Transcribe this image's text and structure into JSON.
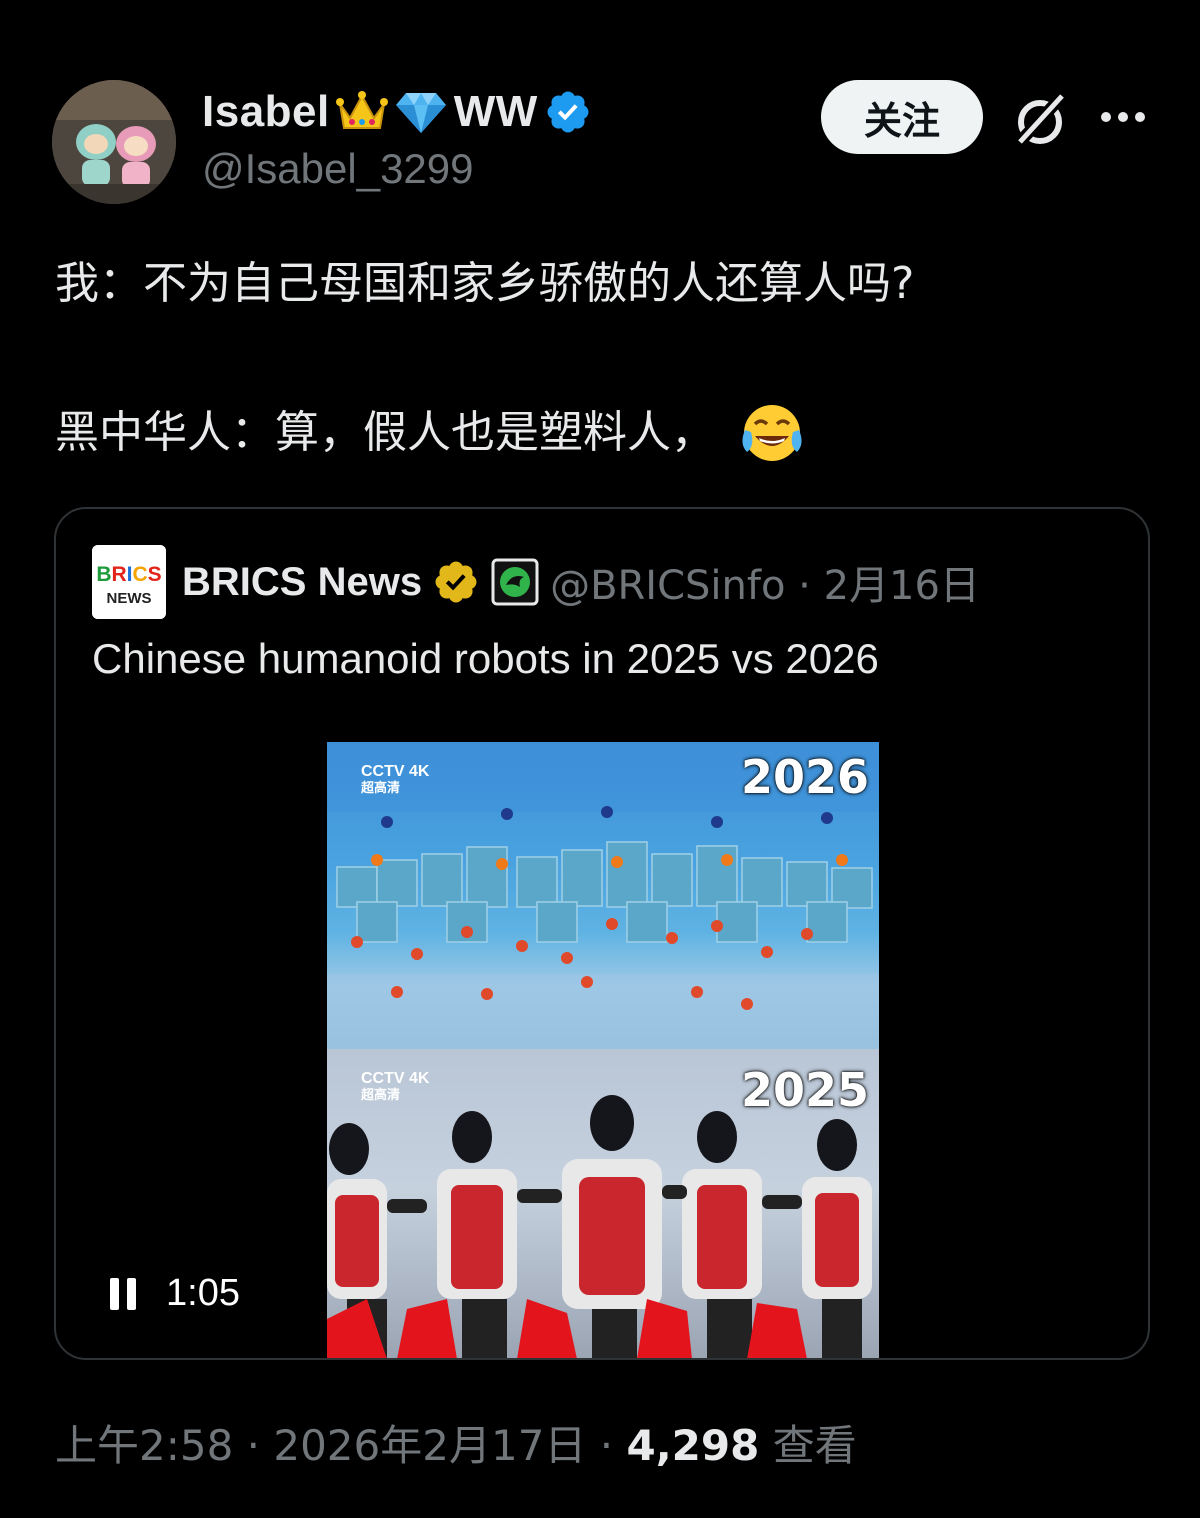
{
  "author": {
    "name": "Isabel",
    "name_suffix": "WW",
    "handle": "@Isabel_3299",
    "follow_label": "关注"
  },
  "post": {
    "line1": "我：不为自己母国和家乡骄傲的人还算人吗?",
    "line2": "黑中华人：算，假人也是塑料人，"
  },
  "quoted": {
    "logo_top": "BRICS",
    "logo_bottom": "NEWS",
    "name": "BRICS News",
    "handle_date": "@BRICSinfo · 2月16日",
    "text": "Chinese humanoid robots in 2025 vs 2026",
    "video": {
      "top_year": "2026",
      "bottom_year": "2025",
      "channel": "CCTV 4K",
      "channel_sub": "超高清",
      "duration": "1:05"
    }
  },
  "meta": {
    "time_date": "上午2:58 · 2026年2月17日 · ",
    "views": "4,298",
    "views_label": " 查看"
  },
  "colors": {
    "background": "#000000",
    "verified_blue": "#1d9bf0",
    "verified_gold": "#e2b719",
    "secondary_text": "#71767b"
  }
}
